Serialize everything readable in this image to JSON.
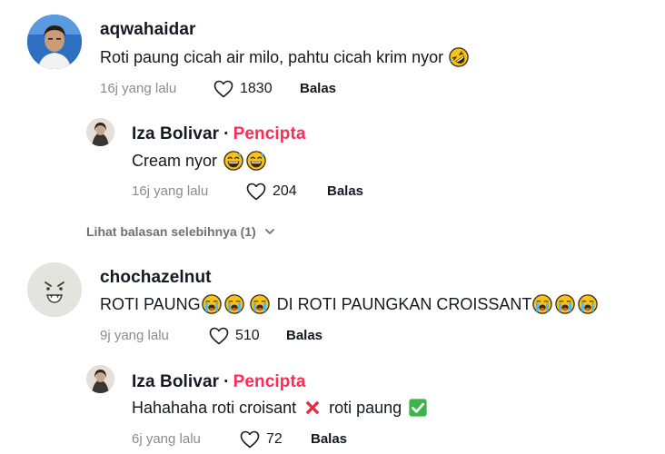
{
  "comments": [
    {
      "username": "aqwahaidar",
      "text": "Roti paung cicah air milo, pahtu cicah krim nyor",
      "emoji": "rolling-laughing-emoji",
      "time": "16j yang lalu",
      "likes": "1830",
      "reply": "Balas",
      "replies": [
        {
          "username": "Iza Bolivar",
          "tag": "Pencipta",
          "text": "Cream nyor",
          "emoji": "grinning-sweat-emoji",
          "time": "16j yang lalu",
          "likes": "204",
          "reply": "Balas"
        }
      ],
      "view_more": "Lihat balasan selebihnya (1)"
    },
    {
      "username": "chochazelnut",
      "text_part1": "ROTI PAUNG",
      "text_part2": "DI ROTI PAUNGKAN CROISSANT",
      "emoji": "loudly-crying-emoji",
      "time": "9j yang lalu",
      "likes": "510",
      "reply": "Balas",
      "replies": [
        {
          "username": "Iza Bolivar",
          "tag": "Pencipta",
          "text_part1": "Hahahaha roti croisant",
          "text_part2": "roti paung",
          "emoji1": "cross-mark-emoji",
          "emoji2": "check-mark-emoji",
          "time": "6j yang lalu",
          "likes": "72",
          "reply": "Balas"
        }
      ]
    }
  ],
  "colors": {
    "creator": "#fe2c55",
    "meta": "#8a8b91",
    "text": "#161823"
  }
}
